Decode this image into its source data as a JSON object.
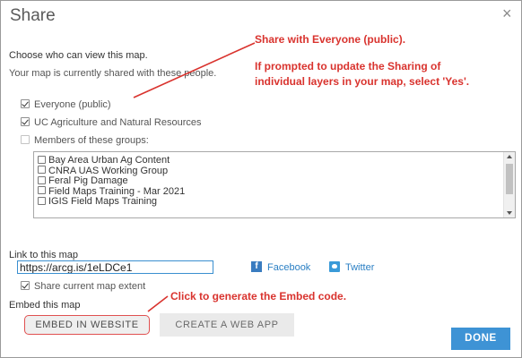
{
  "dialog": {
    "title": "Share",
    "close_glyph": "×"
  },
  "visibility": {
    "heading": "Choose who can view this map.",
    "subtext": "Your map is currently shared with these people.",
    "options": [
      {
        "label": "Everyone (public)",
        "checked": true
      },
      {
        "label": "UC Agriculture and Natural Resources",
        "checked": true
      },
      {
        "label": "Members of these groups:",
        "checked": false
      }
    ]
  },
  "groups": [
    {
      "label": "Bay Area Urban Ag Content",
      "checked": false
    },
    {
      "label": "CNRA UAS Working Group",
      "checked": false
    },
    {
      "label": "Feral Pig Damage",
      "checked": false
    },
    {
      "label": "Field Maps Training - Mar 2021",
      "checked": false
    },
    {
      "label": "IGIS Field Maps Training",
      "checked": false
    }
  ],
  "link": {
    "heading": "Link to this map",
    "url": "https://arcg.is/1eLDCe1",
    "share_extent_label": "Share current map extent",
    "share_extent_checked": true,
    "facebook_label": "Facebook",
    "facebook_icon": "facebook-icon",
    "twitter_label": "Twitter",
    "twitter_icon": "twitter-icon"
  },
  "embed": {
    "heading": "Embed this map",
    "embed_button": "EMBED IN WEBSITE",
    "webapp_button": "CREATE A WEB APP"
  },
  "footer": {
    "done_button": "DONE"
  },
  "annotations": {
    "share_line1": "Share with Everyone (public).",
    "share_line2": "If prompted to update the Sharing of",
    "share_line3": "individual layers in your map, select 'Yes'.",
    "embed_note": "Click to generate the Embed code.",
    "color": "#d9332e"
  },
  "colors": {
    "accent": "#3e93d5",
    "link": "#2a7fc4",
    "embed_highlight": "#e05050"
  }
}
